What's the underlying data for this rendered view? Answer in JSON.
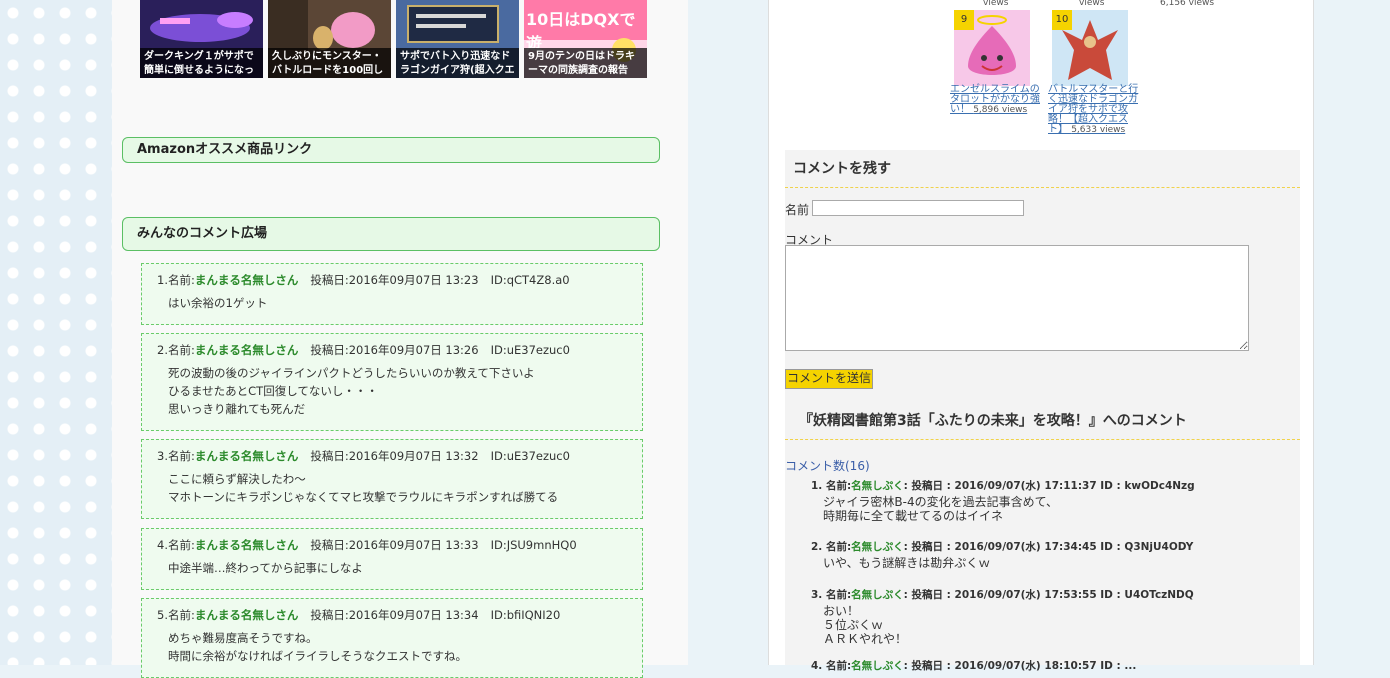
{
  "thumbnails": [
    {
      "caption": "ダークキング１がサポで簡単に倒せるようになっ"
    },
    {
      "caption": "久しぶりにモンスター・バトルロードを100回してき"
    },
    {
      "caption": "サポでバト入り迅速なドラゴンガイア狩(超入クエ"
    },
    {
      "caption": "9月のテンの日はドラキーマの同族調査の報告"
    }
  ],
  "thumbnail_overlay_text": "10日はDQXで遊",
  "amazon_section": {
    "title": "Amazonオススメ商品リンク"
  },
  "comment_section": {
    "title": "みんなのコメント広場"
  },
  "comments": [
    {
      "num": "1.名前:",
      "name": "まんまる名無しさん",
      "posted": "投稿日:2016年09月07日 13:23",
      "id": "ID:qCT4Z8.a0",
      "lines": [
        "はい余裕の1ゲット"
      ]
    },
    {
      "num": "2.名前:",
      "name": "まんまる名無しさん",
      "posted": "投稿日:2016年09月07日 13:26",
      "id": "ID:uE37ezuc0",
      "lines": [
        "死の波動の後のジャイラインパクトどうしたらいいのか教えて下さいよ",
        "ひるませたあとCT回復してないし・・・",
        "思いっきり離れても死んだ"
      ]
    },
    {
      "num": "3.名前:",
      "name": "まんまる名無しさん",
      "posted": "投稿日:2016年09月07日 13:32",
      "id": "ID:uE37ezuc0",
      "lines": [
        "ここに頼らず解決したわ～",
        "マホトーンにキラポンじゃなくてマヒ攻撃でラウルにキラポンすれば勝てる"
      ]
    },
    {
      "num": "4.名前:",
      "name": "まんまる名無しさん",
      "posted": "投稿日:2016年09月07日 13:33",
      "id": "ID:JSU9mnHQ0",
      "lines": [
        "中途半端…終わってから記事にしなよ"
      ]
    },
    {
      "num": "5.名前:",
      "name": "まんまる名無しさん",
      "posted": "投稿日:2016年09月07日 13:34",
      "id": "ID:bfiIQNI20",
      "lines": [
        "めちゃ難易度高そうですね。",
        "時間に余裕がなければイライラしそうなクエストですね。"
      ]
    }
  ],
  "ranking": {
    "top_views": [
      "views",
      "views",
      "6,156 views"
    ],
    "items": [
      {
        "rank": "9",
        "title": "エンゼルスライムのタロットがかなり強い！",
        "views": "5,896 views"
      },
      {
        "rank": "10",
        "title": "バトルマスターと行く迅速なドラゴンガイア狩をサポで攻略！【超入クエスト】",
        "views": "5,633 views"
      }
    ]
  },
  "form": {
    "title": "コメントを残す",
    "name_label": "名前",
    "comment_label": "コメント",
    "name_value": "",
    "comment_value": "",
    "submit_label": "コメントを送信"
  },
  "comments_list": {
    "title": "『妖精図書館第3話「ふたりの未来」を攻略！』へのコメント",
    "count": "コメント数(16)",
    "items": [
      {
        "label": "1. 名前:",
        "name": "名無しぷく",
        "meta": ": 投稿日 : 2016/09/07(水) 17:11:37 ID : kwODc4Nzg",
        "lines": [
          "ジャイラ密林B-4の変化を過去記事含めて、",
          "時期毎に全て載せてるのはイイネ"
        ]
      },
      {
        "label": "2. 名前:",
        "name": "名無しぷく",
        "meta": ": 投稿日 : 2016/09/07(水) 17:34:45 ID : Q3NjU4ODY",
        "lines": [
          "いや、もう謎解きは勘弁ぷくｗ"
        ]
      },
      {
        "label": "3. 名前:",
        "name": "名無しぷく",
        "meta": ": 投稿日 : 2016/09/07(水) 17:53:55 ID : U4OTczNDQ",
        "lines": [
          "おい！",
          "５位ぷくｗ",
          "ＡＲＫやれや！"
        ]
      },
      {
        "label": "4. 名前:",
        "name": "名無しぷく",
        "meta": ": 投稿日 : 2016/09/07(水) 18:10:57 ID : ...",
        "lines": []
      }
    ]
  }
}
